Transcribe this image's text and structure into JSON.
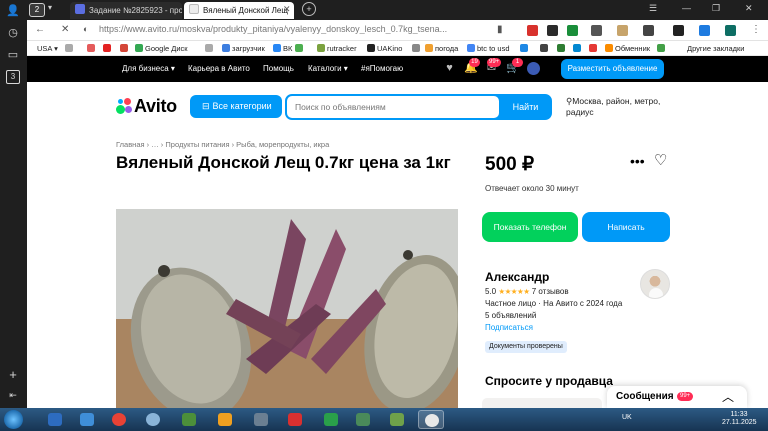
{
  "browser": {
    "tab_count": "2",
    "tabs": [
      {
        "label": "Задание №2825923 - про",
        "icon": "sp-favicon"
      },
      {
        "label": "Вяленый Донской Лещ",
        "icon": "avito-favicon"
      }
    ],
    "url": "https://www.avito.ru/moskva/produkty_pitaniya/vyalenyy_donskoy_lesch_0.7kg_tsena...",
    "bookmarks": [
      "USA",
      "Google Диск",
      "загрузчик",
      "ВК",
      "rutracker",
      "UAKino",
      "погода",
      "btc to usd",
      "Обменник"
    ],
    "other_bookmarks": "Другие закладки"
  },
  "avito_nav": {
    "links": [
      "Для бизнеса",
      "Карьера в Авито",
      "Помощь",
      "Каталоги",
      "#яПомогаю"
    ],
    "badges": [
      "19",
      "99+",
      "1"
    ],
    "post_button": "Разместить объявление"
  },
  "header": {
    "logo": "Avito",
    "categories_button": "Все категории",
    "search_placeholder": "Поиск по объявлениям",
    "search_button": "Найти",
    "location": "Москва, район, метро, радиус"
  },
  "listing": {
    "breadcrumbs": "Главная  ›  …  ›  Продукты питания  ›  Рыба, морепродукты, икра",
    "title": "Вяленый Донской Лещ 0.7кг цена за 1кг",
    "price": "500 ₽",
    "reply_time": "Отвечает около 30 минут",
    "show_phone_button": "Показать телефон",
    "write_button": "Написать"
  },
  "seller": {
    "name": "Александр",
    "rating": "5.0",
    "stars": "★★★★★",
    "reviews": "7 отзывов",
    "type": "Частное лицо · На Авито с 2024 года",
    "ads": "5 объявлений",
    "subscribe": "Подписаться",
    "docs_badge": "Документы проверены"
  },
  "ask": {
    "title": "Спросите у продавца"
  },
  "messages": {
    "label": "Сообщения",
    "badge": "99+"
  },
  "taskbar": {
    "lang": "UK",
    "time": "11:33",
    "date": "27.11.2025"
  },
  "colors": {
    "accent_blue": "#0099f7",
    "phone_green": "#02d15c",
    "badge_red": "#ff2d55",
    "star_yellow": "#ffb021"
  }
}
